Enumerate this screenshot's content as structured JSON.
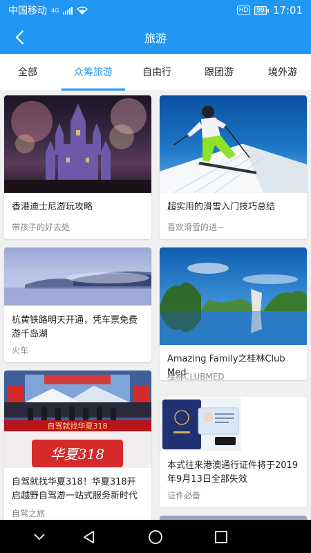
{
  "status_bar": {
    "carrier": "中国移动",
    "network": "4G",
    "hd": "HD",
    "battery": "99",
    "time": "17:01"
  },
  "app_bar": {
    "title": "旅游",
    "back_icon": "chevron-left-icon"
  },
  "tabs": [
    {
      "label": "全部",
      "active": false
    },
    {
      "label": "众筹旅游",
      "active": true
    },
    {
      "label": "自由行",
      "active": false
    },
    {
      "label": "跟团游",
      "active": false
    },
    {
      "label": "境外游",
      "active": false
    }
  ],
  "cards": [
    {
      "title": "香港迪士尼游玩攻略",
      "subtitle": "带孩子的好去处",
      "image": "disneyland-castle-fireworks"
    },
    {
      "title": "超实用的滑雪入门技巧总结",
      "subtitle": "喜欢滑雪的进~",
      "image": "skier-on-slope"
    },
    {
      "title": "杭黄铁路明天开通，凭车票免费游千岛湖",
      "subtitle": "火车",
      "image": "misty-lake-islands"
    },
    {
      "title": "Amazing Family之桂林Club Med",
      "subtitle": "桂林CLUBMED",
      "image": "guilin-karst-lake"
    },
    {
      "title": "自驾就找华夏318！华夏318开启越野自驾游一站式服务新时代",
      "subtitle": "自驾之旅",
      "image": "launch-event-stage",
      "image_text": "自驾就找华夏318"
    },
    {
      "title": "本式往来港澳通行证件将于2019年9月13日全部失效",
      "subtitle": "证件必备",
      "image": "passport-and-permit"
    }
  ],
  "nav_bar": {
    "back_icon": "triangle-back-icon",
    "home_icon": "circle-home-icon",
    "recents_icon": "square-recents-icon",
    "hide_icon": "chevron-down-icon"
  },
  "colors": {
    "accent": "#2196f3",
    "background": "#f0f0f0",
    "nav": "#000000"
  }
}
